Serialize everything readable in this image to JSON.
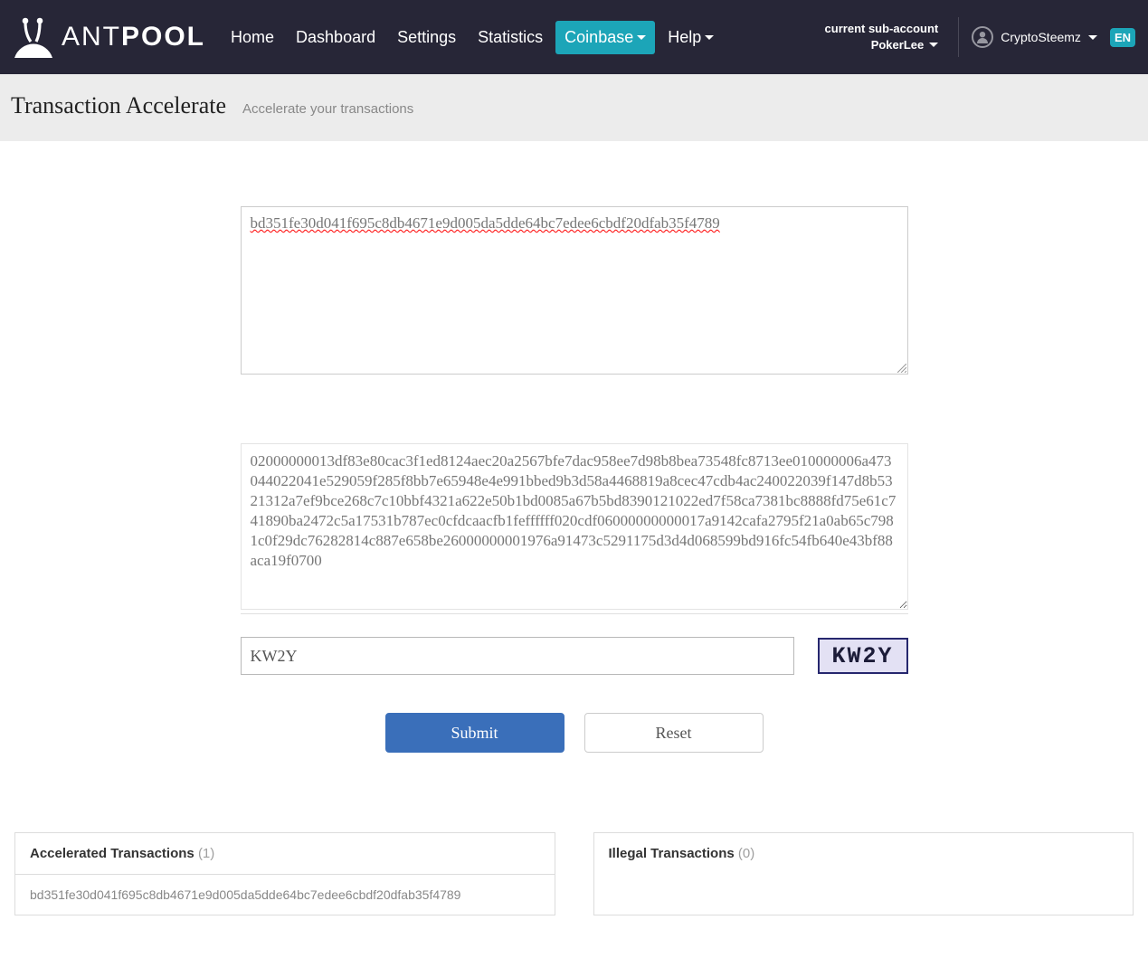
{
  "brand": {
    "prefix": "ANT",
    "suffix": "POOL"
  },
  "nav": {
    "home": "Home",
    "dashboard": "Dashboard",
    "settings": "Settings",
    "statistics": "Statistics",
    "coinbase": "Coinbase",
    "help": "Help"
  },
  "account": {
    "label": "current sub-account",
    "name": "PokerLee",
    "user": "CryptoSteemz",
    "lang": "EN"
  },
  "page": {
    "title": "Transaction Accelerate",
    "subtitle": "Accelerate your transactions"
  },
  "form": {
    "txid": "bd351fe30d041f695c8db4671e9d005da5dde64bc7edee6cbdf20dfab35f4789",
    "raw": "02000000013df83e80cac3f1ed8124aec20a2567bfe7dac958ee7d98b8bea73548fc8713ee010000006a473044022041e529059f285f8bb7e65948e4e991bbed9b3d58a4468819a8cec47cdb4ac240022039f147d8b5321312a7ef9bce268c7c10bbf4321a622e50b1bd0085a67b5bd8390121022ed7f58ca7381bc8888fd75e61c741890ba2472c5a17531b787ec0cfdcaacfb1feffffff020cdf06000000000017a9142cafa2795f21a0ab65c7981c0f29dc76282814c887e658be26000000001976a91473c5291175d3d4d068599bd916fc54fb640e43bf88aca19f0700",
    "captcha": "KW2Y",
    "captcha_img": "KW2Y",
    "submit": "Submit",
    "reset": "Reset"
  },
  "results": {
    "accel_label": "Accelerated Transactions",
    "accel_count": "(1)",
    "accel_rows": [
      "bd351fe30d041f695c8db4671e9d005da5dde64bc7edee6cbdf20dfab35f4789"
    ],
    "illegal_label": "Illegal Transactions",
    "illegal_count": "(0)"
  }
}
